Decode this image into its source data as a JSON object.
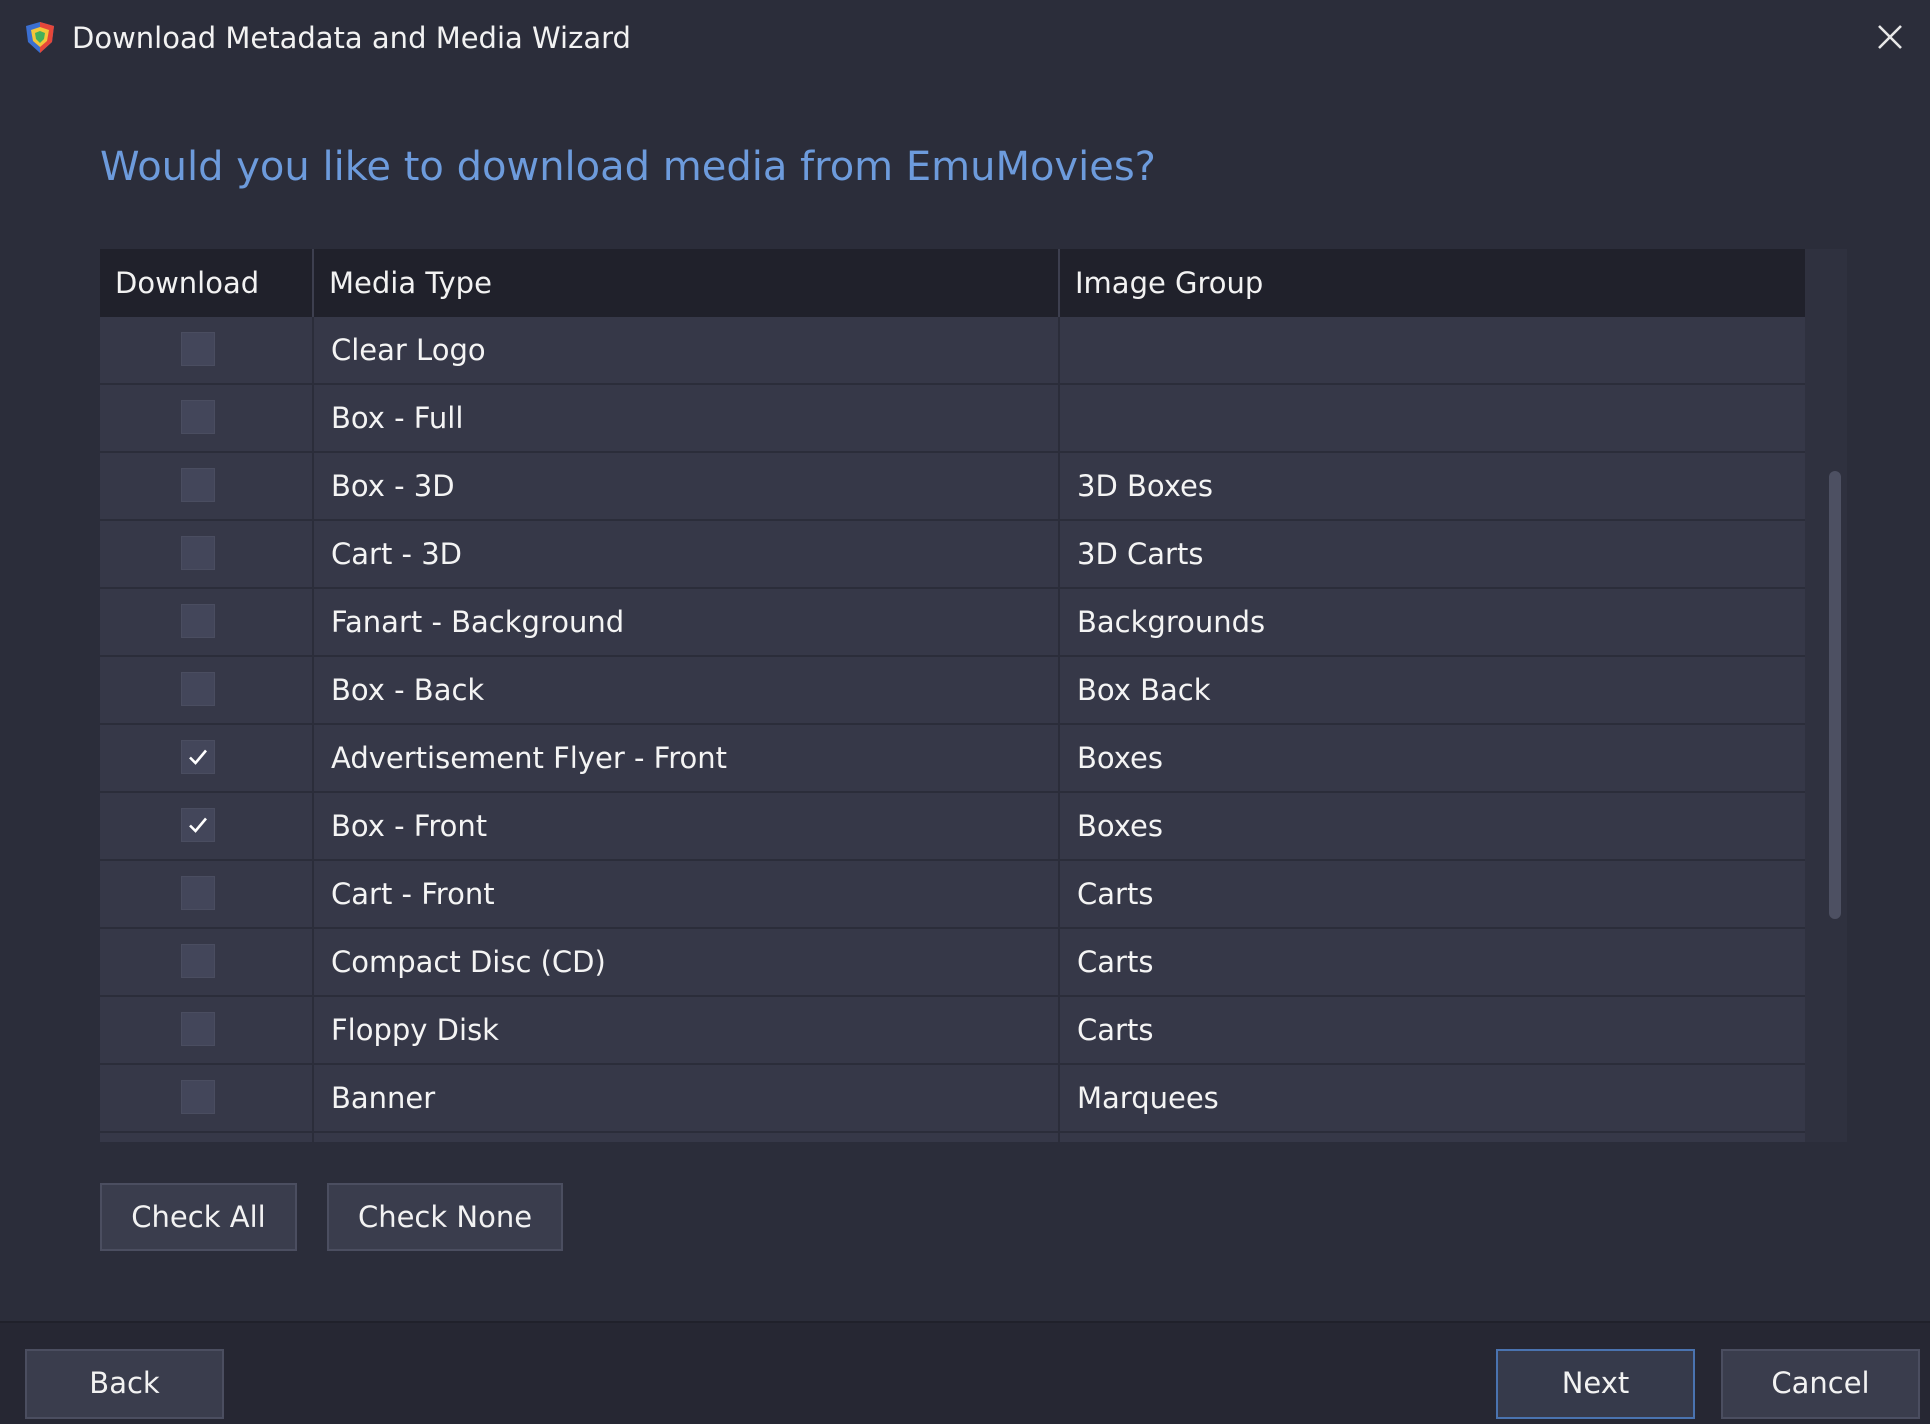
{
  "window": {
    "title": "Download Metadata and Media Wizard"
  },
  "heading": "Would you like to download media from EmuMovies?",
  "table": {
    "columns": [
      "Download",
      "Media Type",
      "Image Group"
    ],
    "rows": [
      {
        "checked": false,
        "media_type": "Clear Logo",
        "image_group": ""
      },
      {
        "checked": false,
        "media_type": "Box - Full",
        "image_group": ""
      },
      {
        "checked": false,
        "media_type": "Box - 3D",
        "image_group": "3D Boxes"
      },
      {
        "checked": false,
        "media_type": "Cart - 3D",
        "image_group": "3D Carts"
      },
      {
        "checked": false,
        "media_type": "Fanart - Background",
        "image_group": "Backgrounds"
      },
      {
        "checked": false,
        "media_type": "Box - Back",
        "image_group": "Box Back"
      },
      {
        "checked": true,
        "media_type": "Advertisement Flyer - Front",
        "image_group": "Boxes"
      },
      {
        "checked": true,
        "media_type": "Box - Front",
        "image_group": "Boxes"
      },
      {
        "checked": false,
        "media_type": "Cart - Front",
        "image_group": "Carts"
      },
      {
        "checked": false,
        "media_type": "Compact Disc (CD)",
        "image_group": "Carts"
      },
      {
        "checked": false,
        "media_type": "Floppy Disk",
        "image_group": "Carts"
      },
      {
        "checked": false,
        "media_type": "Banner",
        "image_group": "Marquees"
      },
      {
        "checked": false,
        "media_type": "",
        "image_group": ""
      }
    ]
  },
  "buttons": {
    "check_all": "Check All",
    "check_none": "Check None",
    "back": "Back",
    "next": "Next",
    "cancel": "Cancel"
  },
  "icons": {
    "app": "launchbox-app-icon",
    "close": "close-icon",
    "check": "checkmark-icon"
  },
  "colors": {
    "heading": "#6d9bdc",
    "background": "#2b2d3a",
    "row": "#363848",
    "header": "#20212b",
    "next_border": "#4a73b0"
  }
}
